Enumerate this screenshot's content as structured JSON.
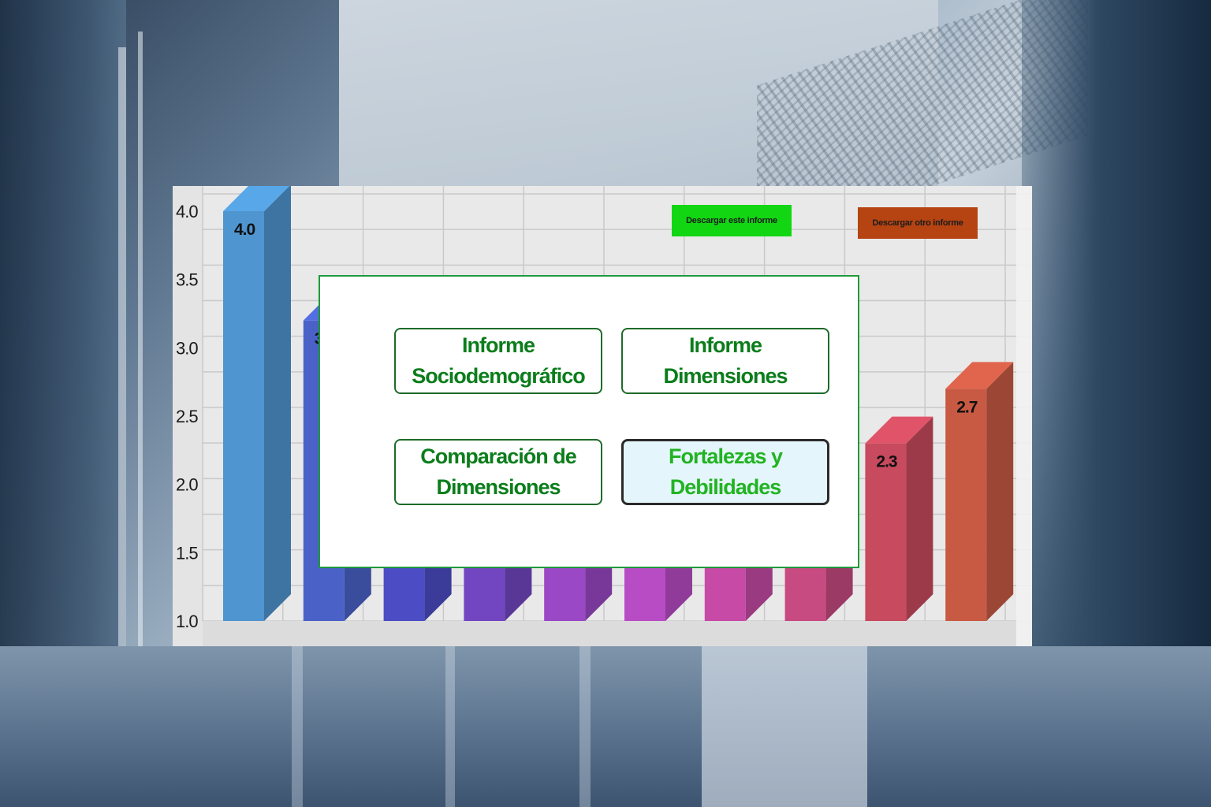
{
  "background": {
    "scene": "office-interior"
  },
  "chart_data": {
    "type": "bar",
    "categories": [
      "",
      "",
      "",
      "",
      "",
      "",
      "",
      "",
      "",
      ""
    ],
    "values": [
      4.0,
      3.2,
      1.4,
      1.4,
      1.4,
      1.4,
      1.4,
      1.4,
      2.3,
      2.7
    ],
    "value_labels": [
      "4.0",
      "3",
      "",
      "",
      "",
      "",
      "",
      "",
      "2.3",
      "2.7"
    ],
    "y_ticks": [
      "1.0",
      "1.5",
      "2.0",
      "2.5",
      "3.0",
      "3.5",
      "4.0"
    ],
    "ylim": [
      1.0,
      4.0
    ],
    "title": "",
    "xlabel": "",
    "ylabel": "",
    "grid": true,
    "colors": [
      "#4f95d0",
      "#4a62c8",
      "#4c4cc4",
      "#7246c0",
      "#9a48c6",
      "#b84cc4",
      "#c64aa6",
      "#c74a80",
      "#c84a5e",
      "#c85a44"
    ]
  },
  "toolbar": {
    "download_this": "Descargar este informe",
    "download_other": "Descargar otro informe",
    "download_this_color": "#12d612",
    "download_other_color": "#b54412"
  },
  "dialog": {
    "options": [
      {
        "line1": "Informe",
        "line2": "Sociodemográfico"
      },
      {
        "line1": "Informe",
        "line2": "Dimensiones"
      },
      {
        "line1": "Comparación de",
        "line2": "Dimensiones"
      },
      {
        "line1": "Fortalezas y",
        "line2": "Debilidades"
      }
    ],
    "border_color": "#1f9a3b",
    "text_color": "#0b7d1b",
    "selected_text_color": "#22b322"
  }
}
